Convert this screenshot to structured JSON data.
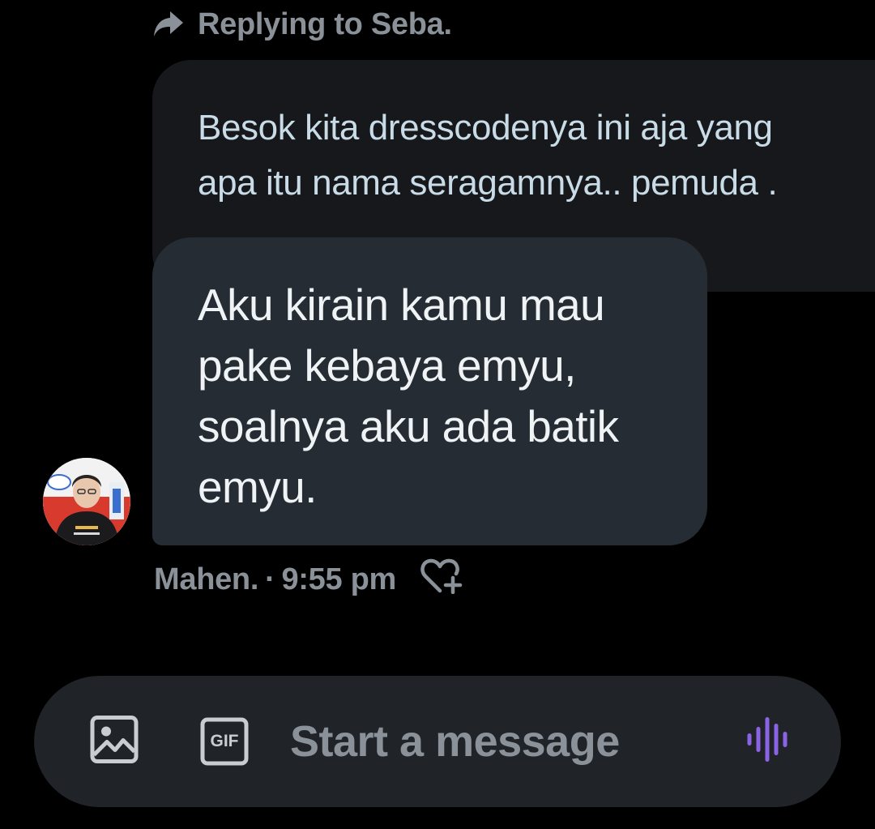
{
  "reply_header": {
    "icon": "reply-arrow-icon",
    "text": "Replying to Seba."
  },
  "quoted_message": {
    "lines": [
      "Besok kita dresscodenya ini aja yang",
      "apa itu nama seragamnya.. pemuda ."
    ]
  },
  "message": {
    "lines": [
      "Aku kirain kamu mau",
      "pake kebaya emyu,",
      "soalnya aku ada batik",
      "emyu."
    ]
  },
  "meta": {
    "sender": "Mahen.",
    "separator": "·",
    "time": "9:55 pm",
    "react_icon": "heart-plus-icon"
  },
  "composer": {
    "placeholder": "Start a message",
    "media_icon": "image-icon",
    "gif_label": "GIF",
    "voice_icon": "voice-wave-icon"
  },
  "colors": {
    "background": "#000000",
    "quoted_bubble": "#16181c",
    "message_bubble": "#252c34",
    "composer": "#202327",
    "muted_text": "#8b9199",
    "quoted_text": "#c8dbe6",
    "voice_accent": "#8a63e6"
  }
}
